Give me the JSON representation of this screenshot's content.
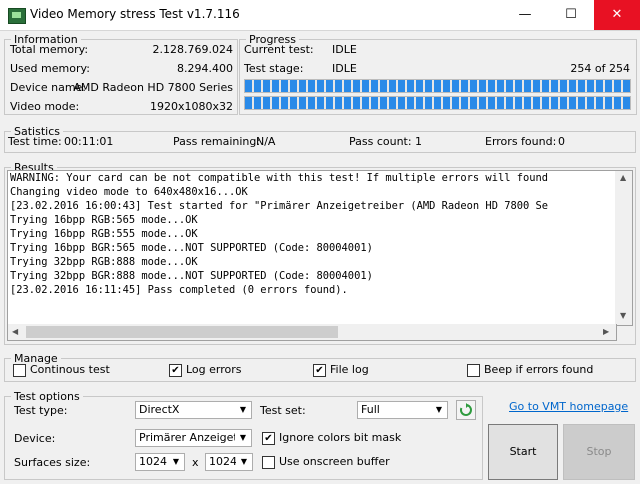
{
  "window": {
    "title": "Video Memory stress Test v1.7.116",
    "minimize_glyph": "—",
    "maximize_glyph": "☐",
    "close_glyph": "✕"
  },
  "information": {
    "legend": "Information",
    "rows": [
      {
        "label": "Total memory:",
        "value": "2.128.769.024"
      },
      {
        "label": "Used memory:",
        "value": "8.294.400"
      },
      {
        "label": "Device name:",
        "value": "AMD Radeon HD 7800 Series"
      },
      {
        "label": "Video mode:",
        "value": "1920x1080x32"
      }
    ]
  },
  "progress": {
    "legend": "Progress",
    "current_test_label": "Current test:",
    "current_test_value": "IDLE",
    "test_stage_label": "Test stage:",
    "test_stage_value": "IDLE",
    "stage_count": "254 of 254",
    "bar1_fraction": 1.0,
    "bar2_fraction": 1.0
  },
  "statistics": {
    "legend": "Satistics",
    "test_time_label": "Test time:",
    "test_time_value": "00:11:01",
    "pass_remaining_label": "Pass remaining:",
    "pass_remaining_value": "N/A",
    "pass_count_label": "Pass count:",
    "pass_count_value": "1",
    "errors_found_label": "Errors found:",
    "errors_found_value": "0"
  },
  "results": {
    "legend": "Results",
    "lines": [
      "WARNING: Your card can be not compatible with this test! If multiple errors will found",
      "Changing video mode to 640x480x16...OK",
      "[23.02.2016 16:00:43] Test started for \"Primärer Anzeigetreiber (AMD Radeon HD 7800 Se",
      "Trying 16bpp RGB:565 mode...OK",
      "Trying 16bpp RGB:555 mode...OK",
      "Trying 16bpp BGR:565 mode...NOT SUPPORTED (Code: 80004001)",
      "Trying 32bpp RGB:888 mode...OK",
      "Trying 32bpp BGR:888 mode...NOT SUPPORTED (Code: 80004001)",
      "[23.02.2016 16:11:45] Pass completed (0 errors found)."
    ]
  },
  "manage": {
    "legend": "Manage",
    "continuous_test_label": "Continous test",
    "continuous_test_checked": false,
    "log_errors_label": "Log errors",
    "log_errors_checked": true,
    "file_log_label": "File log",
    "file_log_checked": true,
    "beep_label": "Beep if errors found",
    "beep_checked": false
  },
  "test_options": {
    "legend": "Test options",
    "test_type_label": "Test type:",
    "test_type_value": "DirectX",
    "test_set_label": "Test set:",
    "test_set_value": "Full",
    "device_label": "Device:",
    "device_value": "Primärer Anzeigetrei",
    "ignore_colors_label": "Ignore colors bit mask",
    "ignore_colors_checked": true,
    "surfaces_label": "Surfaces size:",
    "surface_width": "1024",
    "surface_x": "x",
    "surface_height": "1024",
    "onscreen_label": "Use onscreen buffer",
    "onscreen_checked": false
  },
  "actions": {
    "vmt_link": "Go to VMT homepage",
    "start_label": "Start",
    "stop_label": "Stop"
  },
  "colors": {
    "progress_blue": "#2a8ae8",
    "refresh_green": "#2e9b3e",
    "close_red": "#e81123",
    "link_blue": "#0066cc"
  }
}
